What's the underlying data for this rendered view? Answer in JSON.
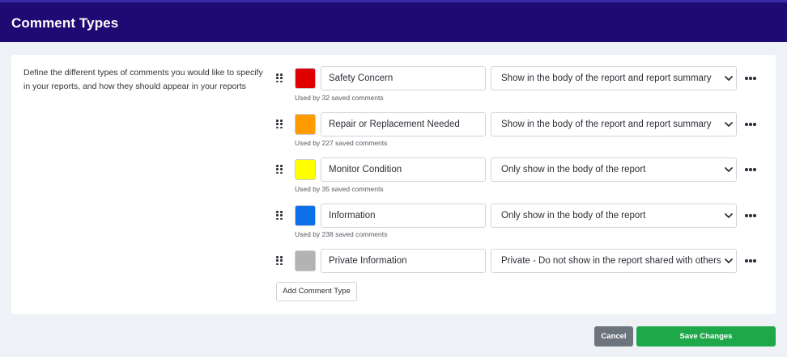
{
  "header": {
    "title": "Comment Types"
  },
  "description": "Define the different types of comments you would like to specify in your reports, and how they should appear in your reports",
  "comment_types": [
    {
      "name": "Safety Concern",
      "color": "#e00000",
      "visibility": "Show in the body of the report and report summary",
      "usage": "Used by 32 saved comments"
    },
    {
      "name": "Repair or Replacement Needed",
      "color": "#ff9a00",
      "visibility": "Show in the body of the report and report summary",
      "usage": "Used by 227 saved comments"
    },
    {
      "name": "Monitor Condition",
      "color": "#ffff00",
      "visibility": "Only show in the body of the report",
      "usage": "Used by 35 saved comments"
    },
    {
      "name": "Information",
      "color": "#0a6fe8",
      "visibility": "Only show in the body of the report",
      "usage": "Used by 238 saved comments"
    },
    {
      "name": "Private Information",
      "color": "#b3b3b3",
      "visibility": "Private - Do not show in the report shared with others",
      "usage": ""
    }
  ],
  "buttons": {
    "add": "Add Comment Type",
    "cancel": "Cancel",
    "save": "Save Changes"
  },
  "icons": {
    "drag": "drag-handle-icon",
    "chevron": "chevron-down-icon",
    "more": "more-horizontal-icon"
  }
}
